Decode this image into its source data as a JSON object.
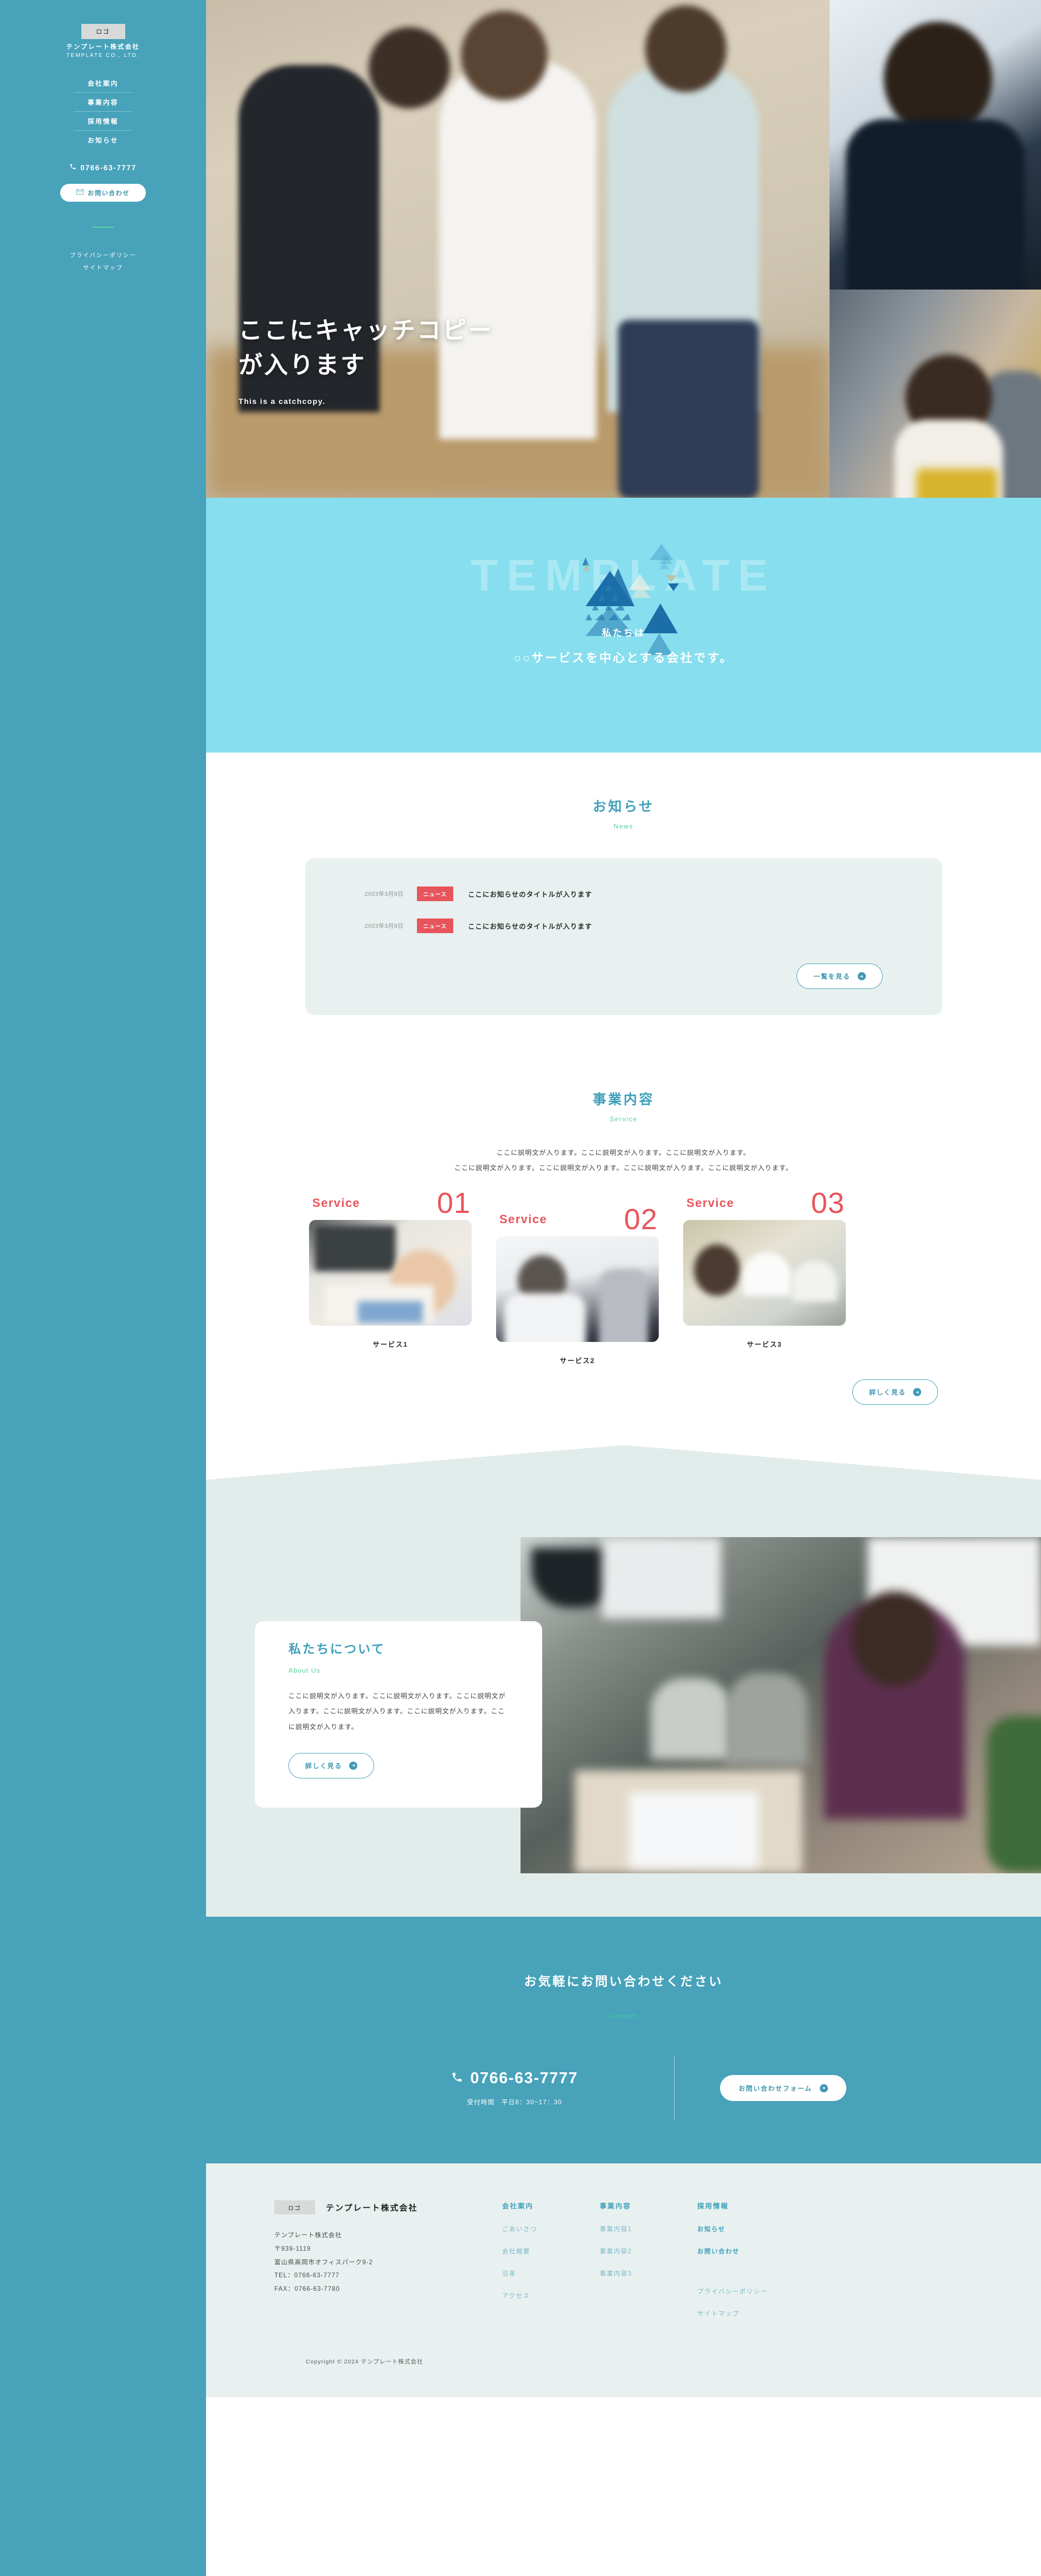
{
  "brand": {
    "logo_text": "ロゴ",
    "company_jp": "テンプレート株式会社",
    "company_en": "TEMPLATE CO., LTD.",
    "accent_teal": "#47A2BA",
    "accent_light_teal": "#86DEEE",
    "accent_green": "#4DD39A",
    "accent_red": "#E8545B"
  },
  "sidebar": {
    "nav": [
      {
        "label": "会社案内"
      },
      {
        "label": "事業内容"
      },
      {
        "label": "採用情報"
      },
      {
        "label": "お知らせ"
      }
    ],
    "tel": "0766-63-7777",
    "contact_button": "お問い合わせ",
    "sub_links": [
      {
        "label": "プライバシーポリシー"
      },
      {
        "label": "サイトマップ"
      }
    ]
  },
  "hero": {
    "title_line1": "ここにキャッチコピー",
    "title_line2": "が入ります",
    "subtitle": "This is a catchcopy."
  },
  "band": {
    "ghost_text": "TEMPLATE",
    "line1": "私たちは",
    "line2": "○○サービスを中心とする会社です。"
  },
  "news": {
    "title": "お知らせ",
    "title_en": "News",
    "items": [
      {
        "date": "2023年3月8日",
        "badge": "ニュース",
        "title": "ここにお知らせのタイトルが入ります"
      },
      {
        "date": "2023年3月8日",
        "badge": "ニュース",
        "title": "ここにお知らせのタイトルが入ります"
      }
    ],
    "more_button": "一覧を見る"
  },
  "service": {
    "title": "事業内容",
    "title_en": "Service",
    "lead_line1": "ここに説明文が入ります。ここに説明文が入ります。ここに説明文が入ります。",
    "lead_line2": "ここに説明文が入ります。ここに説明文が入ります。ここに説明文が入ります。ここに説明文が入ります。",
    "cards": [
      {
        "label": "Service",
        "number": "01",
        "name": "サービス1"
      },
      {
        "label": "Service",
        "number": "02",
        "name": "サービス2"
      },
      {
        "label": "Service",
        "number": "03",
        "name": "サービス3"
      }
    ],
    "more_button": "詳しく見る"
  },
  "about": {
    "title": "私たちについて",
    "title_en": "About Us",
    "body": "ここに説明文が入ります。ここに説明文が入ります。ここに説明文が入ります。ここに説明文が入ります。ここに説明文が入ります。ここに説明文が入ります。",
    "more_button": "詳しく見る"
  },
  "contact": {
    "title": "お気軽にお問い合わせください",
    "title_en": "Contact",
    "tel": "0766-63-7777",
    "hours": "受付時間　平日8：30~17：30",
    "form_button": "お問い合わせフォーム"
  },
  "footer": {
    "logo_text": "ロゴ",
    "company": "テンプレート株式会社",
    "address": "テンプレート株式会社\n〒939-1119\n富山県高岡市オフィスパーク9-2\nTEL：0766-63-7777\nFAX：0766-63-7780",
    "columns": [
      {
        "heading": "会社案内",
        "links": [
          {
            "label": "ごあいさつ"
          },
          {
            "label": "会社概要"
          },
          {
            "label": "沿革"
          },
          {
            "label": "アクセス"
          }
        ]
      },
      {
        "heading": "事業内容",
        "links": [
          {
            "label": "事業内容1"
          },
          {
            "label": "事業内容2"
          },
          {
            "label": "事業内容3"
          }
        ]
      },
      {
        "heading": "採用情報",
        "links": [
          {
            "label": "お知らせ"
          },
          {
            "label": "お問い合わせ"
          }
        ]
      }
    ],
    "sub_links": [
      {
        "label": "プライバシーポリシー"
      },
      {
        "label": "サイトマップ"
      }
    ],
    "copyright": "Copyright © 2024 テンプレート株式会社"
  }
}
